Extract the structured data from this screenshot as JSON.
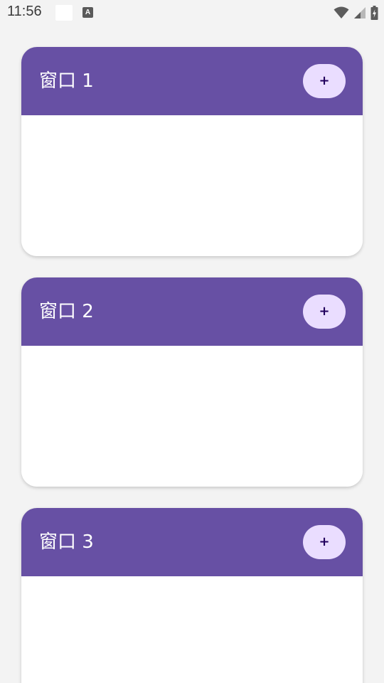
{
  "status_bar": {
    "time": "11:56",
    "notification_badge": "A"
  },
  "cards": [
    {
      "title": "窗口 1",
      "add_label": "+"
    },
    {
      "title": "窗口 2",
      "add_label": "+"
    },
    {
      "title": "窗口 3",
      "add_label": "+"
    }
  ],
  "colors": {
    "header": "#6750a4",
    "add_button_bg": "#eaddff",
    "add_button_fg": "#21005d",
    "background": "#f3f3f3"
  },
  "icons": [
    "wifi-icon",
    "cellular-signal-icon",
    "battery-charging-icon"
  ]
}
